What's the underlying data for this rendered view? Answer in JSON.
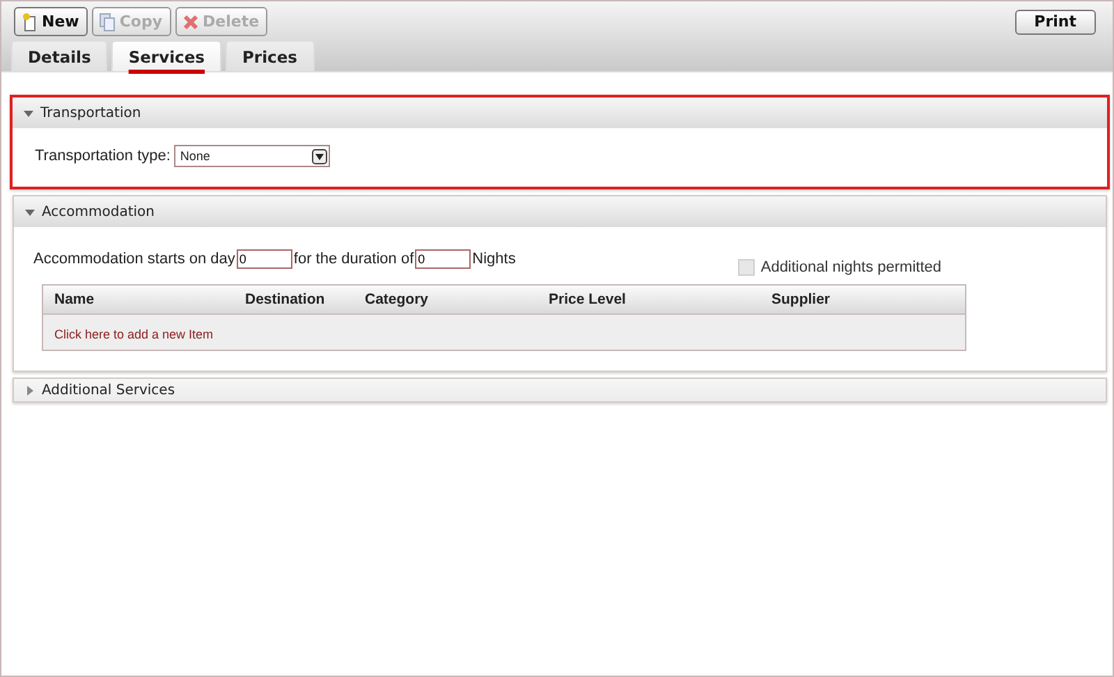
{
  "toolbar": {
    "buttons": [
      {
        "label": "New",
        "kind": "new",
        "disabled": false
      },
      {
        "label": "Copy",
        "kind": "copy",
        "disabled": true
      },
      {
        "label": "Delete",
        "kind": "delete",
        "disabled": true
      }
    ],
    "print": "Print"
  },
  "tabs": [
    {
      "label": "Details",
      "selected": false
    },
    {
      "label": "Services",
      "selected": true
    },
    {
      "label": "Prices",
      "selected": false
    }
  ],
  "sections": [
    {
      "kind": "transport",
      "title": "Transportation",
      "expanded": true,
      "highlighted": true,
      "field_label": "Transportation type:",
      "dropdown_value": "None"
    },
    {
      "kind": "accommodation",
      "title": "Accommodation",
      "expanded": true,
      "highlighted": false,
      "start_label": "Accommodation starts on day",
      "start_value": "0",
      "duration_label": "for the duration of",
      "duration_value": "0",
      "nights_label": "Nights",
      "checkbox": {
        "label": "Additional nights permitted",
        "checked": false,
        "disabled": true
      },
      "table": {
        "columns": [
          "Name",
          "Destination",
          "Category",
          "Price Level",
          "Supplier"
        ],
        "add_link": "Click here to add a new Item"
      }
    },
    {
      "title": "Additional Services",
      "expanded": false,
      "highlighted": false
    }
  ]
}
